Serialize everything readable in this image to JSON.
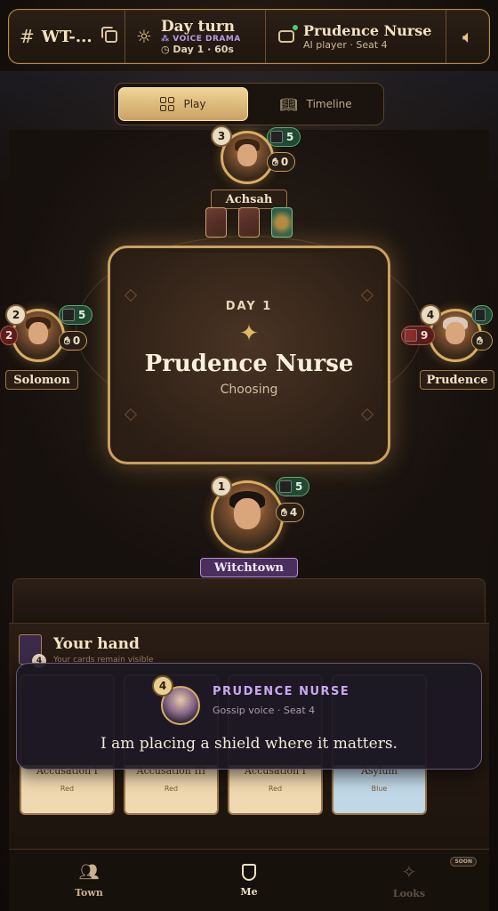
{
  "header": {
    "room_code": "WT-...",
    "turn_title": "Day turn",
    "mode_badge": "VOICE DRAMA",
    "turn_info": "Day 1 · 60s",
    "player_name": "Prudence Nurse",
    "player_sub": "AI player · Seat 4"
  },
  "tabs": [
    {
      "label": "Play",
      "active": true
    },
    {
      "label": "Timeline",
      "active": false
    }
  ],
  "center": {
    "day_label": "DAY 1",
    "current_player": "Prudence Nurse",
    "status": "Choosing"
  },
  "players": {
    "top": {
      "name": "Achsah",
      "seat": "3",
      "cards": "5",
      "hand": "0"
    },
    "left": {
      "name": "Solomon",
      "seat": "2",
      "cards": "5",
      "hand": "0",
      "extra": "2"
    },
    "right": {
      "name": "Prudence",
      "seat": "4",
      "red": "9"
    },
    "me": {
      "name": "Witchtown",
      "seat": "1",
      "cards": "5",
      "hand": "4"
    }
  },
  "hand": {
    "title": "Your hand",
    "subtitle": "Your cards remain visible",
    "count": "4",
    "cards": [
      {
        "title": "Accusation I",
        "color": "Red"
      },
      {
        "title": "Accusation III",
        "color": "Red"
      },
      {
        "title": "Accusation I",
        "color": "Red"
      },
      {
        "title": "Asylum",
        "color": "Blue"
      }
    ]
  },
  "toast": {
    "seat": "4",
    "speaker": "PRUDENCE NURSE",
    "sub": "Gossip voice · Seat 4",
    "message": "I am placing a shield where it matters."
  },
  "nav": {
    "town": "Town",
    "me": "Me",
    "looks": "Looks",
    "soon": "SOON"
  },
  "colors": {
    "accent_gold": "#c9a062",
    "voice_purple": "#b99ae6",
    "good_green": "#1f4a31",
    "bad_red": "#5b1d1b"
  }
}
